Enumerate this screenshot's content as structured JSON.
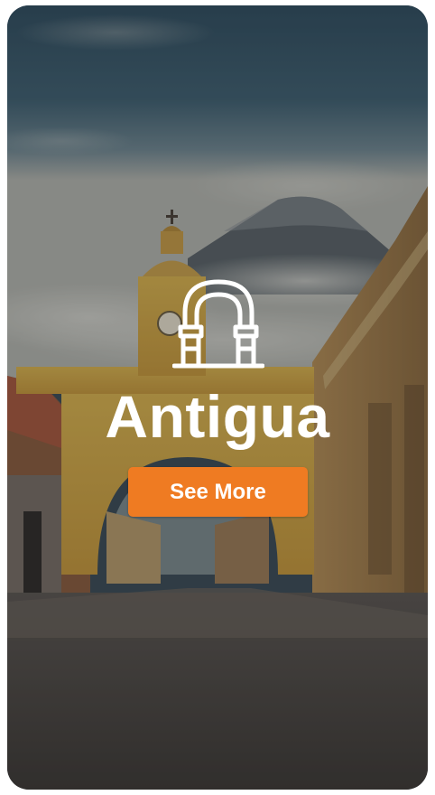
{
  "destination": {
    "title": "Antigua",
    "cta_label": "See More",
    "icon": "arch-icon"
  },
  "colors": {
    "cta_background": "#ef7b22",
    "text": "#ffffff"
  }
}
